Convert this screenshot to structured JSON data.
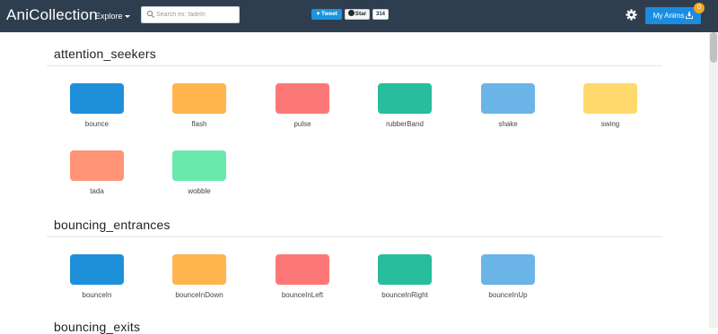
{
  "navbar": {
    "brand": "AniCollection",
    "explore_label": "Explore",
    "search_placeholder": "Search ex: fadeIn",
    "tweet_label": "Tweet",
    "star_label": "Star",
    "star_count": "314",
    "my_anims_label": "My Anims",
    "my_anims_badge": "0"
  },
  "colors": {
    "navbar_bg": "#2f3e4f",
    "blue": "#1e90d9",
    "orange": "#ffb44e",
    "red": "#fc7878",
    "teal": "#28bd9c",
    "lightblue": "#6ab4e8",
    "yellow": "#ffd96c",
    "salmon": "#ff9476",
    "green": "#6ae9ac"
  },
  "sections": [
    {
      "title": "attention_seekers",
      "animations": [
        {
          "name": "bounce",
          "color": "#1e90d9"
        },
        {
          "name": "flash",
          "color": "#ffb44e"
        },
        {
          "name": "pulse",
          "color": "#fc7878"
        },
        {
          "name": "rubberBand",
          "color": "#28bd9c"
        },
        {
          "name": "shake",
          "color": "#6ab4e8"
        },
        {
          "name": "swing",
          "color": "#ffd96c"
        },
        {
          "name": "tada",
          "color": "#ff9476"
        },
        {
          "name": "wobble",
          "color": "#6ae9ac"
        }
      ]
    },
    {
      "title": "bouncing_entrances",
      "animations": [
        {
          "name": "bounceIn",
          "color": "#1e90d9"
        },
        {
          "name": "bounceInDown",
          "color": "#ffb44e"
        },
        {
          "name": "bounceInLeft",
          "color": "#fc7878"
        },
        {
          "name": "bounceInRight",
          "color": "#28bd9c"
        },
        {
          "name": "bounceInUp",
          "color": "#6ab4e8"
        }
      ]
    },
    {
      "title": "bouncing_exits",
      "animations": []
    }
  ]
}
